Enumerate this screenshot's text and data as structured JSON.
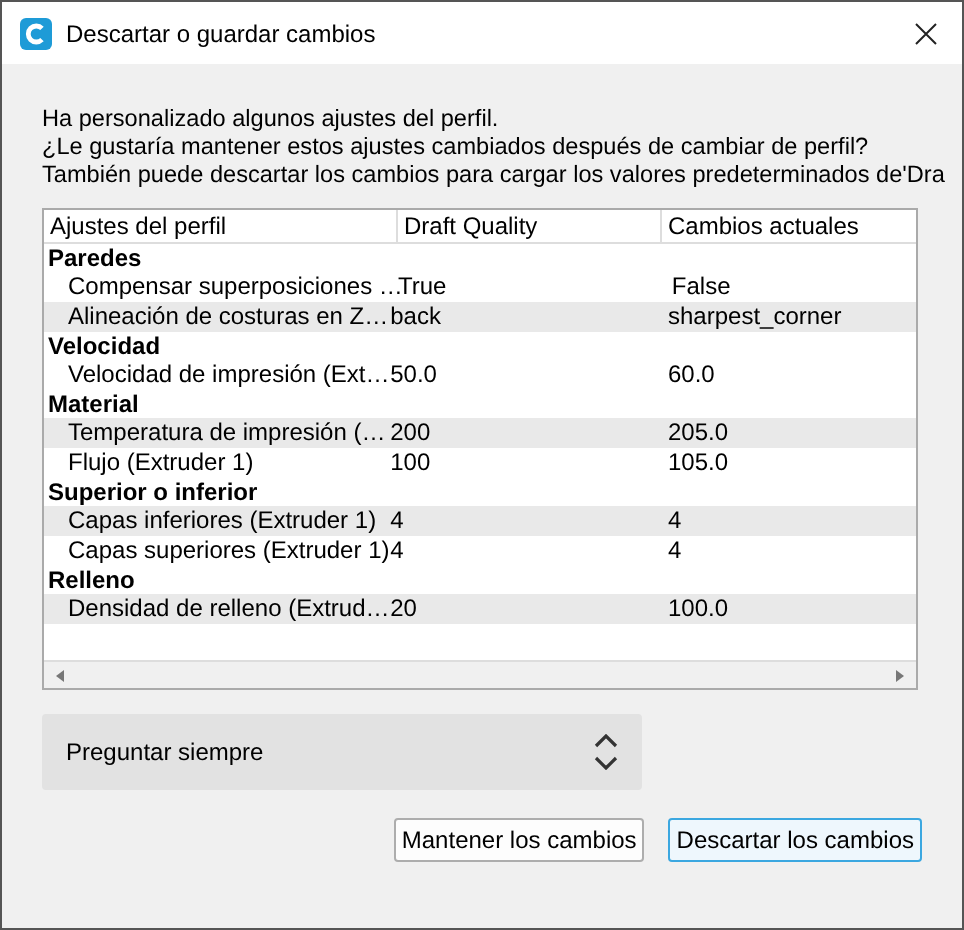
{
  "window": {
    "title": "Descartar o guardar cambios"
  },
  "message": [
    "Ha personalizado algunos ajustes del perfil.",
    "¿Le gustaría mantener estos ajustes cambiados después de cambiar de perfil?",
    "También puede descartar los cambios para cargar los valores predeterminados de'Dra"
  ],
  "table": {
    "columns": [
      "Ajustes del perfil",
      "Draft Quality",
      "Cambios actuales"
    ],
    "groups": [
      {
        "name": "Paredes",
        "rows": [
          [
            "Compensar superposiciones …",
            "True",
            "False"
          ],
          [
            "Alineación de costuras en Z…",
            "back",
            "sharpest_corner"
          ]
        ]
      },
      {
        "name": "Velocidad",
        "rows": [
          [
            "Velocidad de impresión (Ext…",
            "50.0",
            "60.0"
          ]
        ]
      },
      {
        "name": "Material",
        "rows": [
          [
            "Temperatura de impresión (…",
            "200",
            "205.0"
          ],
          [
            "Flujo (Extruder 1)",
            "100",
            "105.0"
          ]
        ]
      },
      {
        "name": "Superior o inferior",
        "rows": [
          [
            "Capas inferiores (Extruder 1)",
            "4",
            "4"
          ],
          [
            "Capas superiores (Extruder 1)",
            "4",
            "4"
          ]
        ]
      },
      {
        "name": "Relleno",
        "rows": [
          [
            "Densidad de relleno (Extrud…",
            "20",
            "100.0"
          ]
        ]
      }
    ]
  },
  "dropdown": {
    "value": "Preguntar siempre"
  },
  "buttons": [
    {
      "label": "Mantener los cambios",
      "focused": false
    },
    {
      "label": "Descartar los cambios",
      "focused": true
    }
  ]
}
